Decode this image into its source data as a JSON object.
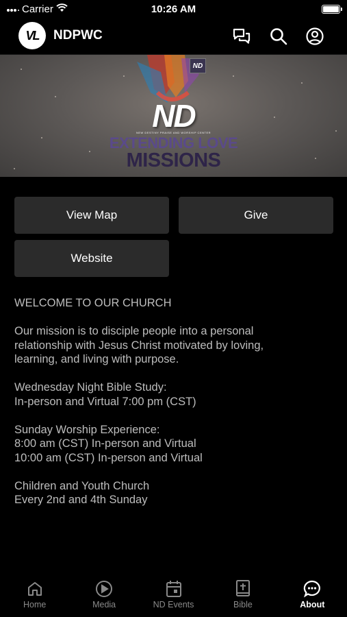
{
  "status_bar": {
    "carrier": "Carrier",
    "time": "10:26 AM"
  },
  "header": {
    "logo_text": "VL",
    "title": "NDPWC"
  },
  "banner": {
    "badge": "ND",
    "logo": "ND",
    "tagline": "NEW DESTINY PRAISE AND WORSHIP CENTER",
    "line1": "EXTENDING LOVE",
    "line2": "MISSIONS"
  },
  "buttons": {
    "view_map": "View Map",
    "give": "Give",
    "website": "Website"
  },
  "content": {
    "paragraphs": [
      "WELCOME TO OUR CHURCH",
      "Our mission is to disciple people into a personal\nrelationship with Jesus Christ motivated by loving,\nlearning, and living with purpose.",
      "Wednesday Night Bible Study:\nIn-person and Virtual 7:00 pm (CST)",
      "Sunday Worship Experience:\n8:00 am (CST) In-person and Virtual\n10:00 am (CST) In-person and Virtual",
      "Children and Youth Church\nEvery 2nd and 4th Sunday"
    ]
  },
  "tabs": [
    {
      "label": "Home",
      "icon": "home-icon"
    },
    {
      "label": "Media",
      "icon": "play-icon"
    },
    {
      "label": "ND Events",
      "icon": "calendar-icon"
    },
    {
      "label": "Bible",
      "icon": "bible-icon"
    },
    {
      "label": "About",
      "icon": "chat-bubble-icon",
      "active": true
    }
  ]
}
